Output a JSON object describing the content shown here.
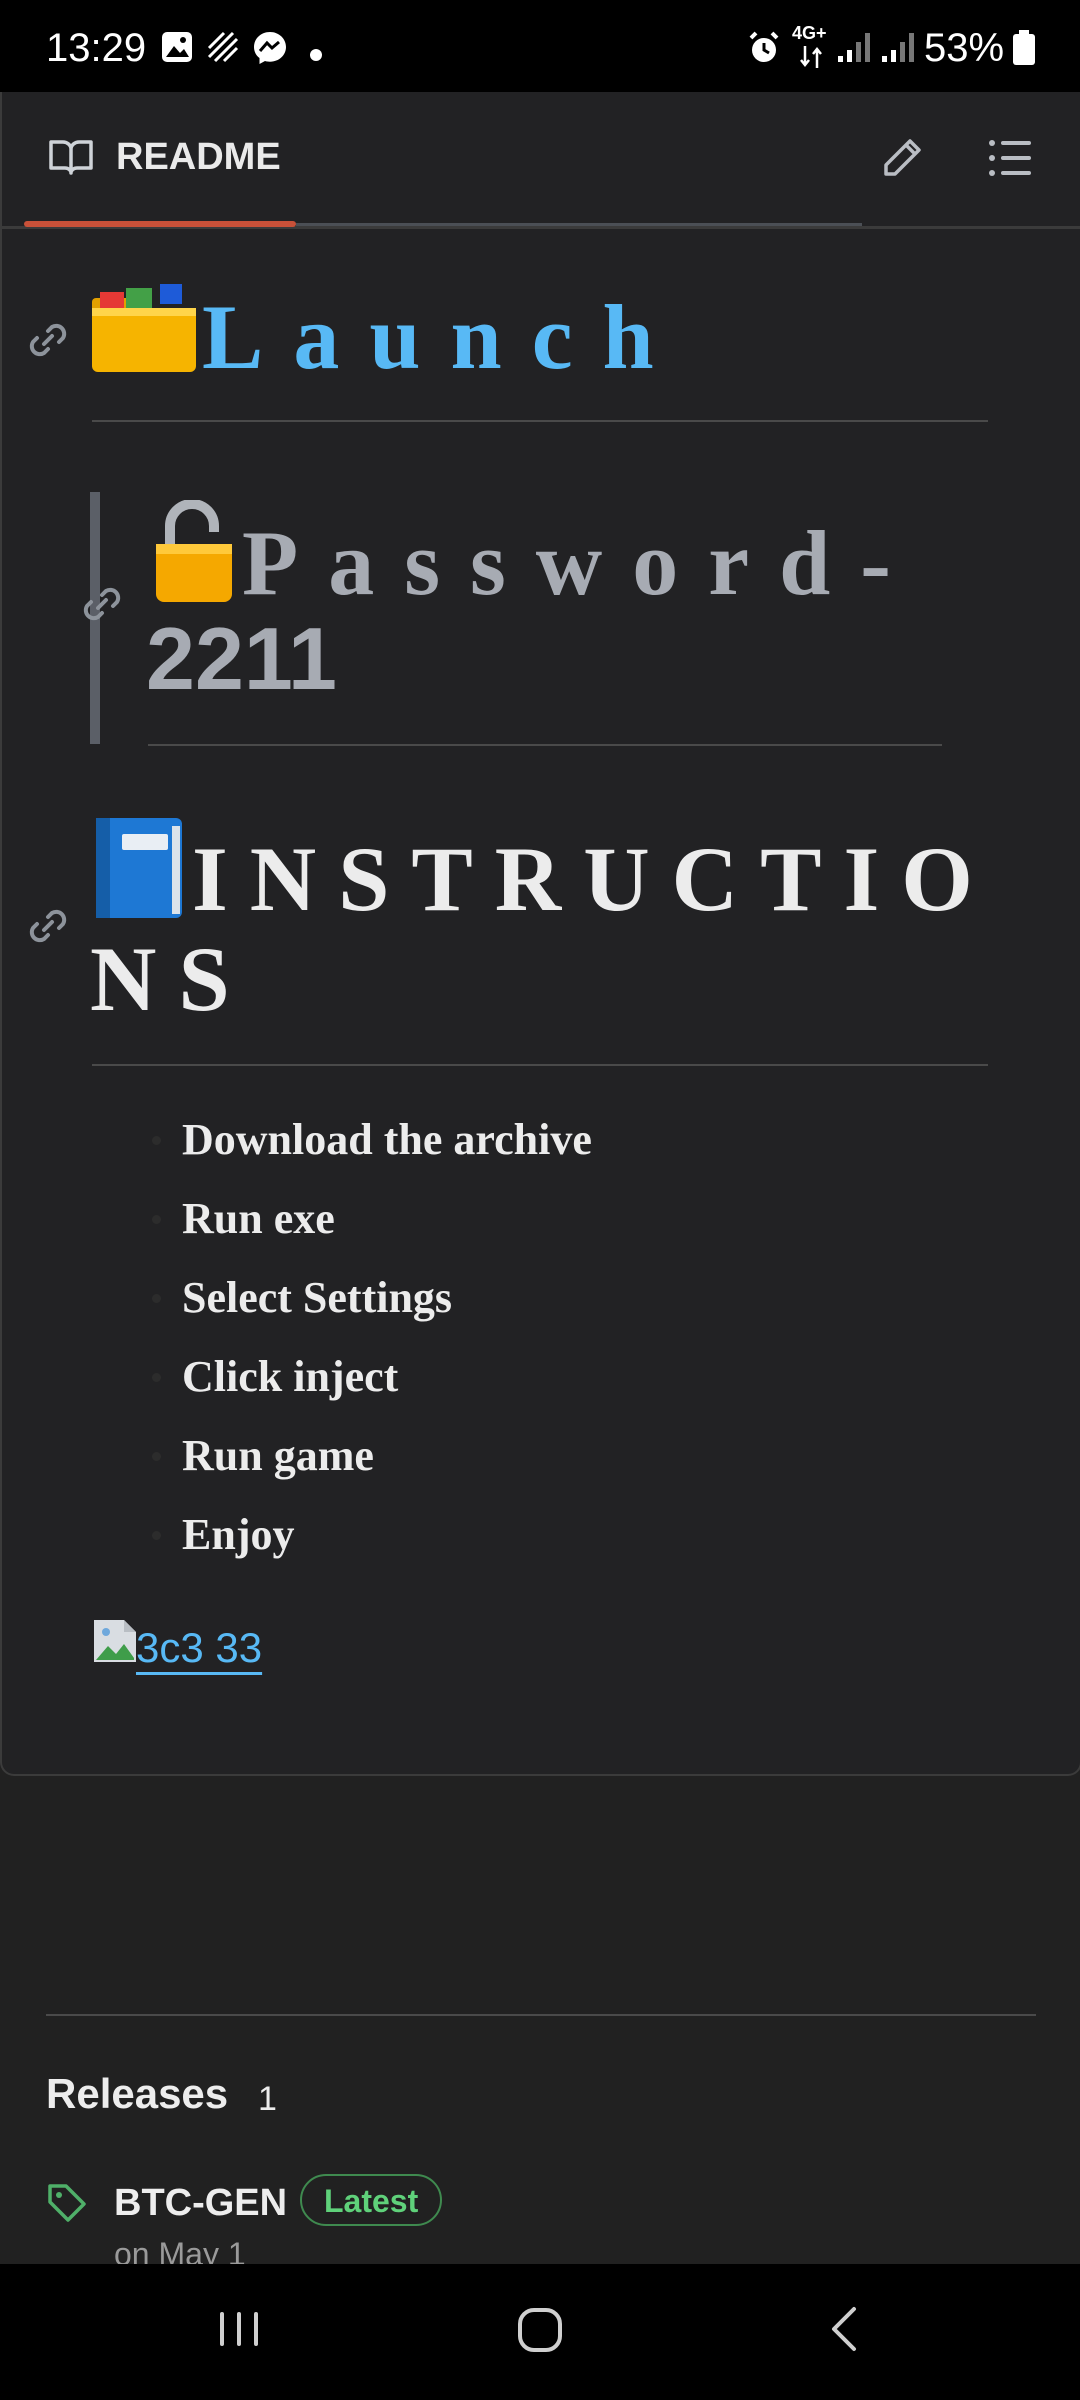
{
  "status_bar": {
    "time": "13:29",
    "network": "4G+",
    "battery": "53%",
    "icons": [
      "gallery-icon",
      "sim-icon",
      "messenger-icon",
      "dot-icon",
      "alarm-icon",
      "signal-icon",
      "signal-icon",
      "battery-icon"
    ]
  },
  "header": {
    "title": "README",
    "icons": [
      "book-icon",
      "pencil-icon",
      "list-icon"
    ]
  },
  "readme": {
    "heading_launch": "Launch",
    "password_line1": "Password-",
    "password_line2": "2211",
    "instructions_line1": "INSTRUCTIO",
    "instructions_line2": "NS",
    "steps": [
      "Download the archive",
      "Run exe",
      "Select Settings",
      "Click inject",
      "Run game",
      "Enjoy"
    ],
    "image_alt": "3c3 33"
  },
  "releases": {
    "title": "Releases",
    "count": "1",
    "release_name": "BTC-GEN",
    "badge": "Latest",
    "date": "on May 1"
  },
  "colors": {
    "background": "#212121",
    "link_blue": "#58b9f5",
    "tab_accent": "#c85139",
    "badge_green": "#5fd17a"
  }
}
